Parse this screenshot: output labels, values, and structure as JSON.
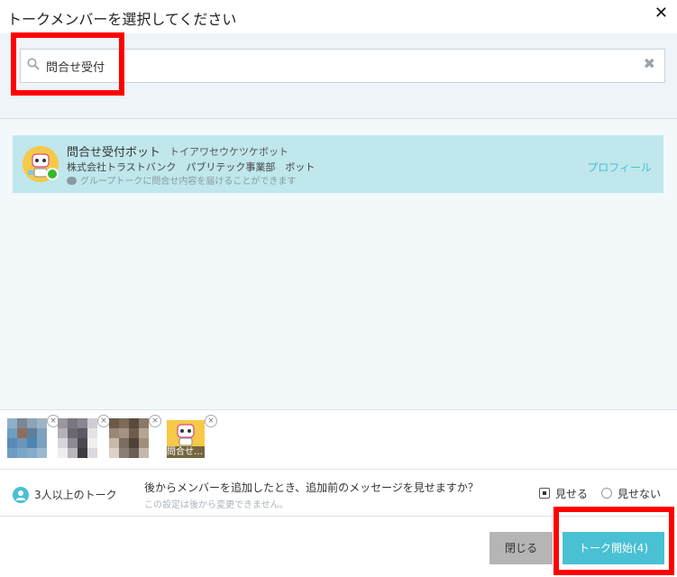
{
  "dialog": {
    "title": "トークメンバーを選択してください",
    "close_glyph": "✕"
  },
  "search": {
    "value": "問合せ受付",
    "placeholder": "",
    "clear_glyph": "✖"
  },
  "result": {
    "name": "問合せ受付ボット",
    "kana": "トイアワセウケツケボット",
    "org": "株式会社トラストバンク　パブリテック事業部　ボット",
    "description": "グループトークに問合せ内容を届けることができます",
    "profile_link": "プロフィール",
    "online": true
  },
  "selected_members": {
    "remove_glyph": "×",
    "bot_chip_label": "問合せ…",
    "count": 4
  },
  "options": {
    "group_label": "3人以上のトーク",
    "question": "後からメンバーを追加したとき、追加前のメッセージを見せますか？",
    "note": "この設定は後から変更できません。",
    "show_label": "見せる",
    "hide_label": "見せない",
    "selected": "show"
  },
  "footer": {
    "close_label": "閉じる",
    "start_label": "トーク開始(4)"
  },
  "colors": {
    "accent": "#49c0d4",
    "highlight_row": "#bfe7ec",
    "annotation_red": "#ff0000",
    "online_green": "#35b72f"
  }
}
